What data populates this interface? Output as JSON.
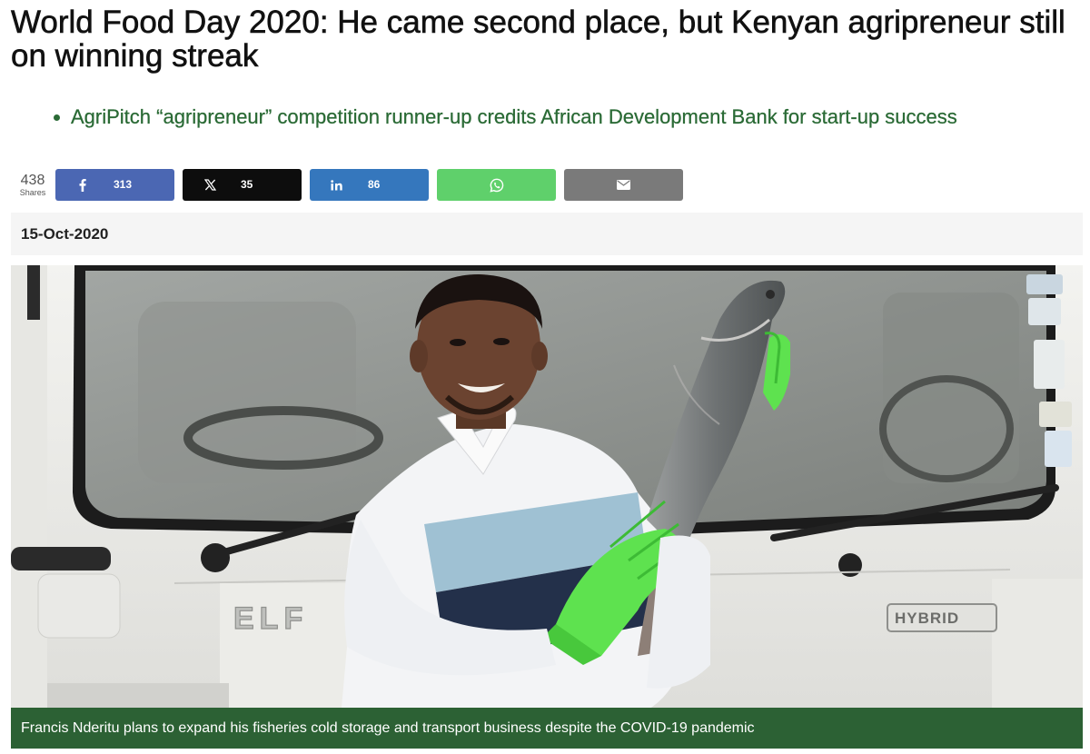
{
  "article": {
    "headline": "World Food Day 2020: He came second place, but Kenyan agripreneur still on winning streak",
    "summary": [
      "AgriPitch “agripreneur” competition runner-up credits African Development Bank for start-up success"
    ],
    "date": "15-Oct-2020",
    "image_caption": "Francis Nderitu plans to expand his fisheries cold storage and transport business despite the COVID-19 pandemic"
  },
  "share": {
    "total": "438",
    "total_label": "Shares",
    "buttons": [
      {
        "network": "facebook",
        "icon": "facebook-icon",
        "count": "313",
        "color": "#4b67b3"
      },
      {
        "network": "x",
        "icon": "x-icon",
        "count": "35",
        "color": "#0d0d0d"
      },
      {
        "network": "linkedin",
        "icon": "linkedin-icon",
        "count": "86",
        "color": "#3577bd"
      },
      {
        "network": "whatsapp",
        "icon": "whatsapp-icon",
        "count": "",
        "color": "#5fd06b"
      },
      {
        "network": "email",
        "icon": "email-icon",
        "count": "",
        "color": "#7a7a7a"
      }
    ]
  },
  "photo": {
    "truck_badge_left": "ELF",
    "truck_badge_right": "HYBRID"
  },
  "colors": {
    "accent_green": "#2a6a35",
    "caption_bg": "#2c6134",
    "date_bar_bg": "#f5f5f5"
  }
}
